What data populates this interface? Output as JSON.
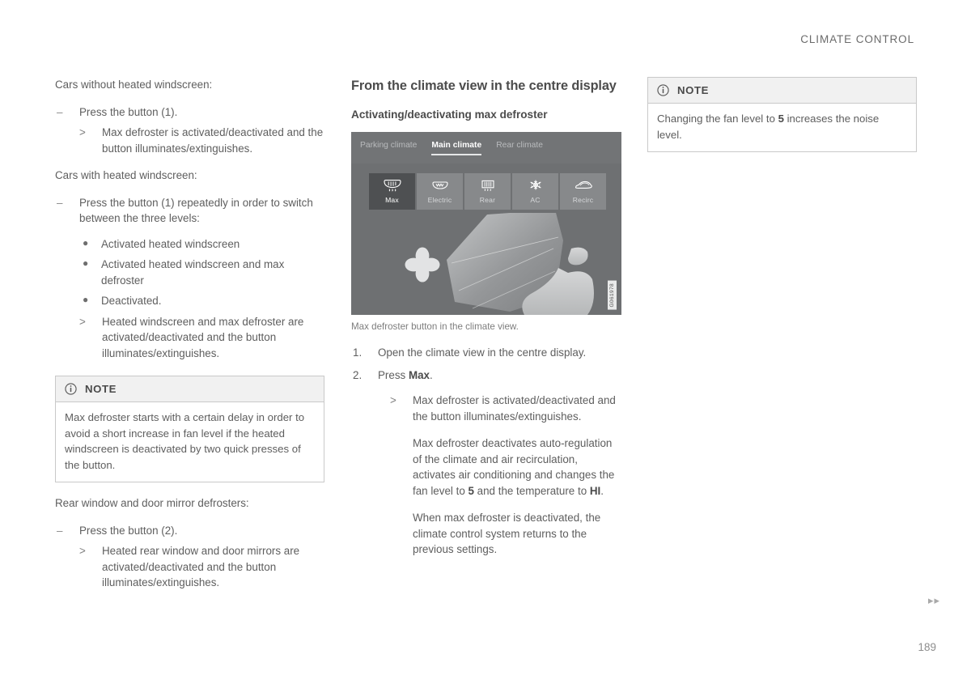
{
  "header": {
    "running_title": "CLIMATE CONTROL"
  },
  "left_column": {
    "intro_without": "Cars without heated windscreen:",
    "step_without": {
      "marker": "–",
      "text": "Press the button (1)."
    },
    "result_without": {
      "marker": ">",
      "text": "Max defroster is activated/deactivated and the button illuminates/extinguishes."
    },
    "intro_with": "Cars with heated windscreen:",
    "step_with": {
      "marker": "–",
      "text": "Press the button (1) repeatedly in order to switch between the three levels:"
    },
    "levels": [
      "Activated heated windscreen",
      "Activated heated windscreen and max defroster",
      "Deactivated."
    ],
    "bullet_marker": "●",
    "result_with": {
      "marker": ">",
      "text": "Heated windscreen and max defroster are activated/deactivated and the button illuminates/extinguishes."
    },
    "note": {
      "title": "NOTE",
      "body": "Max defroster starts with a certain delay in order to avoid a short increase in fan level if the heated windscreen is deactivated by two quick presses of the button."
    },
    "intro_rear": "Rear window and door mirror defrosters:",
    "step_rear": {
      "marker": "–",
      "text": "Press the button (2)."
    },
    "result_rear": {
      "marker": ">",
      "text": "Heated rear window and door mirrors are activated/deactivated and the button illuminates/extinguishes."
    }
  },
  "middle_column": {
    "section_title": "From the climate view in the centre display",
    "sub_title": "Activating/deactivating max defroster",
    "display": {
      "tabs": [
        {
          "label": "Parking climate",
          "active": false
        },
        {
          "label": "Main climate",
          "active": true
        },
        {
          "label": "Rear climate",
          "active": false
        }
      ],
      "buttons": [
        {
          "label": "Max",
          "icon": "max-defroster-icon",
          "active": true
        },
        {
          "label": "Electric",
          "icon": "electric-defroster-icon",
          "active": false
        },
        {
          "label": "Rear",
          "icon": "rear-defroster-icon",
          "active": false
        },
        {
          "label": "AC",
          "icon": "air-conditioning-icon",
          "active": false
        },
        {
          "label": "Recirc",
          "icon": "recirculation-icon",
          "active": false
        }
      ],
      "fan_icon": "fan-icon",
      "image_id": "G061978"
    },
    "caption": "Max defroster button in the climate view.",
    "steps": [
      {
        "marker": "1.",
        "text": "Open the climate view in the centre display."
      },
      {
        "marker": "2.",
        "text_prefix": "Press ",
        "text_bold": "Max",
        "text_suffix": "."
      }
    ],
    "result": {
      "marker": ">",
      "text": "Max defroster is activated/deactivated and the button illuminates/extinguishes."
    },
    "detail_1": {
      "part_1": "Max defroster deactivates auto-regulation of the climate and air recirculation, activates air conditioning and changes the fan level to ",
      "bold_1": "5",
      "part_2": " and the temperature to ",
      "bold_2": "HI",
      "part_3": "."
    },
    "detail_2": "When max defroster is deactivated, the climate control system returns to the previous settings."
  },
  "right_column": {
    "note": {
      "title": "NOTE",
      "body_prefix": "Changing the fan level to ",
      "body_bold": "5",
      "body_suffix": " increases the noise level."
    }
  },
  "footer": {
    "arrows": "▸▸",
    "page_number": "189"
  },
  "colors": {
    "text": "#5e5e5e",
    "heading": "#4c4c4c",
    "note_border": "#c9c9c9",
    "note_header_bg": "#f1f1f1",
    "display_bg": "#6e7072",
    "display_button": "#87898b",
    "display_button_active": "#4e5052"
  }
}
